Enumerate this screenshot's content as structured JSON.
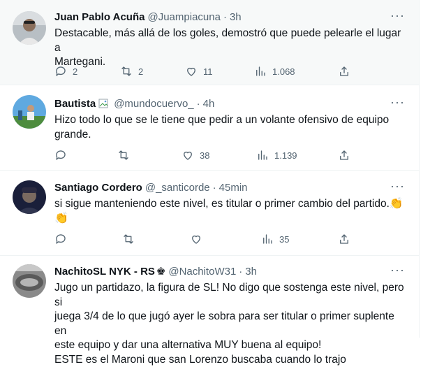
{
  "tweets": [
    {
      "name": "Juan Pablo Acuña",
      "handle": "@Juampiacuna",
      "time": "3h",
      "text": "Destacable, más allá de los goles, demostró que puede pelearle el lugar a\nMartegani.",
      "replies": "2",
      "retweets": "2",
      "likes": "11",
      "views": "1.068"
    },
    {
      "name": "Bautista",
      "handle": "@mundocuervo_",
      "time": "4h",
      "text": "Hizo todo lo que se le tiene que pedir a un volante ofensivo de equipo\ngrande.",
      "replies": "",
      "retweets": "",
      "likes": "38",
      "views": "1.139"
    },
    {
      "name": "Santiago Cordero",
      "handle": "@_santicorde",
      "time": "45min",
      "text": "si sigue manteniendo este nivel, es titular o primer cambio del partido.",
      "emoji": "👏",
      "replies": "",
      "retweets": "",
      "likes": "35",
      "views": ""
    },
    {
      "name": "NachitoSL NYK - RS",
      "name_suffix": "♚",
      "handle": "@NachitoW31",
      "time": "3h",
      "text": "Jugo un partidazo, la figura de SL! No digo que sostenga este nivel, pero si\njuega 3/4 de lo que jugó ayer le sobra para ser titular o primer suplente en\neste equipo y dar una alternativa MUY buena al equipo!\nESTE es el Maroni que san Lorenzo buscaba cuando lo trajo"
    }
  ],
  "more_icon": "···",
  "colors": {
    "secondary": "#536471",
    "highlight_bg": "#f7f9f9",
    "border": "#eff3f4"
  },
  "icons": [
    "reply-icon",
    "retweet-icon",
    "like-icon",
    "views-icon",
    "share-icon",
    "more-icon"
  ]
}
